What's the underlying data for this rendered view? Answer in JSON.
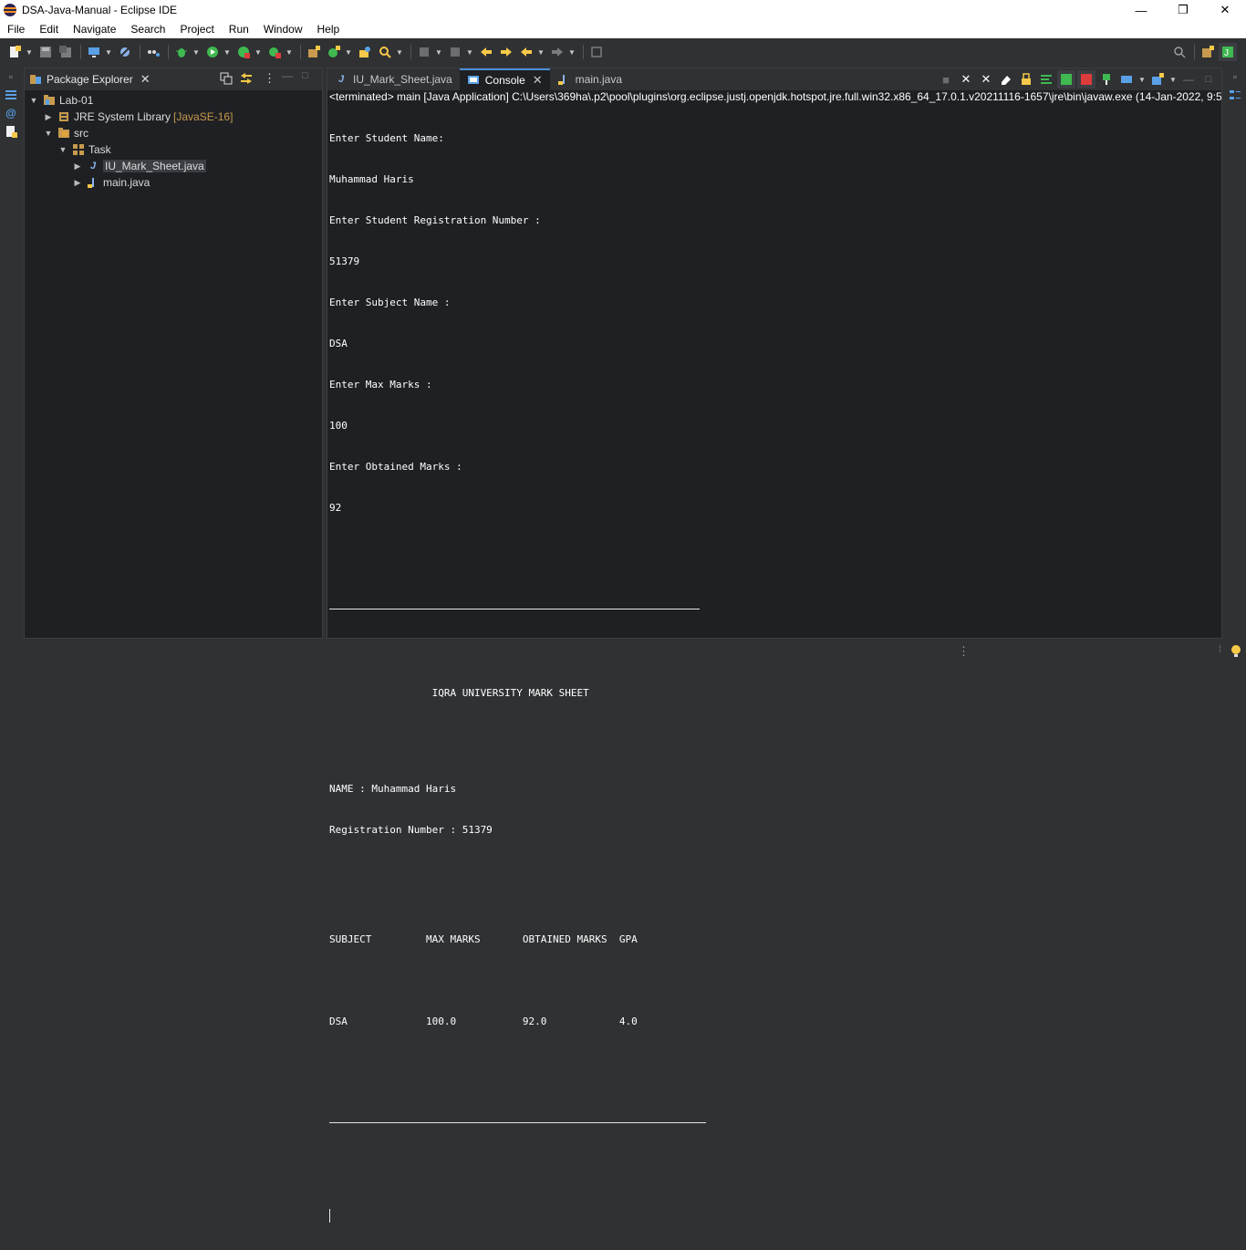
{
  "window": {
    "title": "DSA-Java-Manual - Eclipse IDE",
    "minimize": "—",
    "maximize": "❐",
    "close": "✕"
  },
  "menu": [
    "File",
    "Edit",
    "Navigate",
    "Search",
    "Project",
    "Run",
    "Window",
    "Help"
  ],
  "colors": {
    "accent": "#4c8fd6",
    "background": "#1e2023",
    "chrome": "#2f3133",
    "text": "#ffffff"
  },
  "package_explorer": {
    "title": "Package Explorer",
    "tree": [
      {
        "label": "Lab-01",
        "icon": "project-folder-icon",
        "expanded": true,
        "depth": 0
      },
      {
        "label": "JRE System Library",
        "decor": "[JavaSE-16]",
        "icon": "library-icon",
        "expanded": false,
        "depth": 1
      },
      {
        "label": "src",
        "icon": "source-folder-icon",
        "expanded": true,
        "depth": 1
      },
      {
        "label": "Task",
        "icon": "package-icon",
        "expanded": true,
        "depth": 2
      },
      {
        "label": "IU_Mark_Sheet.java",
        "icon": "java-file-icon",
        "expanded": false,
        "depth": 3,
        "selected": true
      },
      {
        "label": "main.java",
        "icon": "java-file-icon",
        "expanded": false,
        "depth": 3
      }
    ]
  },
  "editor_tabs": [
    {
      "label": "IU_Mark_Sheet.java",
      "icon": "java-file-icon",
      "active": false
    },
    {
      "label": "Console",
      "icon": "console-icon",
      "active": true
    },
    {
      "label": "main.java",
      "icon": "java-file-icon",
      "active": false
    }
  ],
  "console": {
    "terminated": "<terminated> main [Java Application] C:\\Users\\369ha\\.p2\\pool\\plugins\\org.eclipse.justj.openjdk.hotspot.jre.full.win32.x86_64_17.0.1.v20211116-1657\\jre\\bin\\javaw.exe  (14-Jan-2022, 9:58:",
    "input_lines": [
      "Enter Student Name:",
      "Muhammad Haris",
      "Enter Student Registration Number :",
      "51379",
      "Enter Subject Name :",
      "DSA",
      "Enter Max Marks :",
      "100",
      "Enter Obtained Marks :",
      "92"
    ],
    "heading": "                 IQRA UNIVERSITY MARK SHEET",
    "name_line": "NAME : Muhammad Haris",
    "reg_line": "Registration Number : 51379",
    "table_header": "SUBJECT         MAX MARKS       OBTAINED MARKS  GPA",
    "table_row": "DSA             100.0           92.0            4.0"
  }
}
